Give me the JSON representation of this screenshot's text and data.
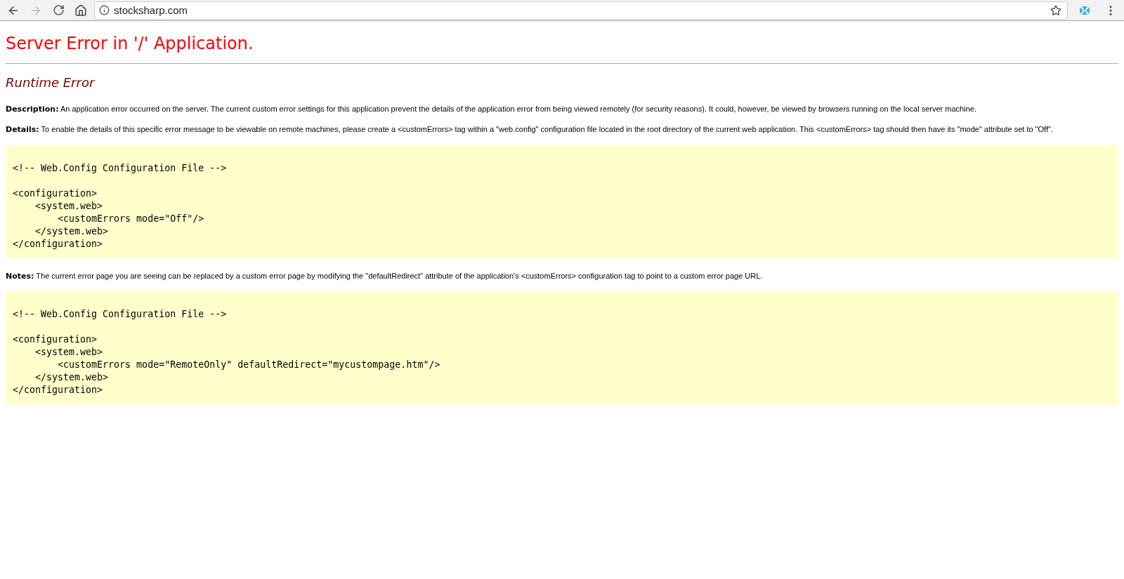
{
  "browser": {
    "address": "stocksharp.com"
  },
  "page": {
    "title": "Server Error in '/' Application.",
    "subtitle": "Runtime Error",
    "sections": [
      {
        "kind": "text",
        "text": "**Description:** An application error occurred on the server. The current custom error settings for this application prevent the details of the application error from being viewed remotely (for security reasons). It could, however, be viewed by browsers running on the local server machine."
      },
      {
        "kind": "text",
        "text": "**Details:** To enable the details of this specific error message to be viewable on remote machines, please create a <customErrors> tag within a \"web.config\" configuration file located in the root directory of the current web application. This <customErrors> tag should then have its \"mode\" attribute set to \"Off\"."
      },
      {
        "kind": "code",
        "comment": "<!-- Web.Config Configuration File -->",
        "lines": [
          "<configuration>",
          "    <system.web>",
          "        <customErrors mode=\"Off\"/>",
          "    </system.web>",
          "</configuration>"
        ]
      },
      {
        "kind": "text",
        "text": "**Notes:** The current error page you are seeing can be replaced by a custom error page by modifying the \"defaultRedirect\" attribute of the application's <customErrors> configuration tag to point to a custom error page URL."
      },
      {
        "kind": "code",
        "comment": "<!-- Web.Config Configuration File -->",
        "lines": [
          "<configuration>",
          "    <system.web>",
          "        <customErrors mode=\"RemoteOnly\" defaultRedirect=\"mycustompage.htm\"/>",
          "    </system.web>",
          "</configuration>"
        ]
      }
    ]
  }
}
